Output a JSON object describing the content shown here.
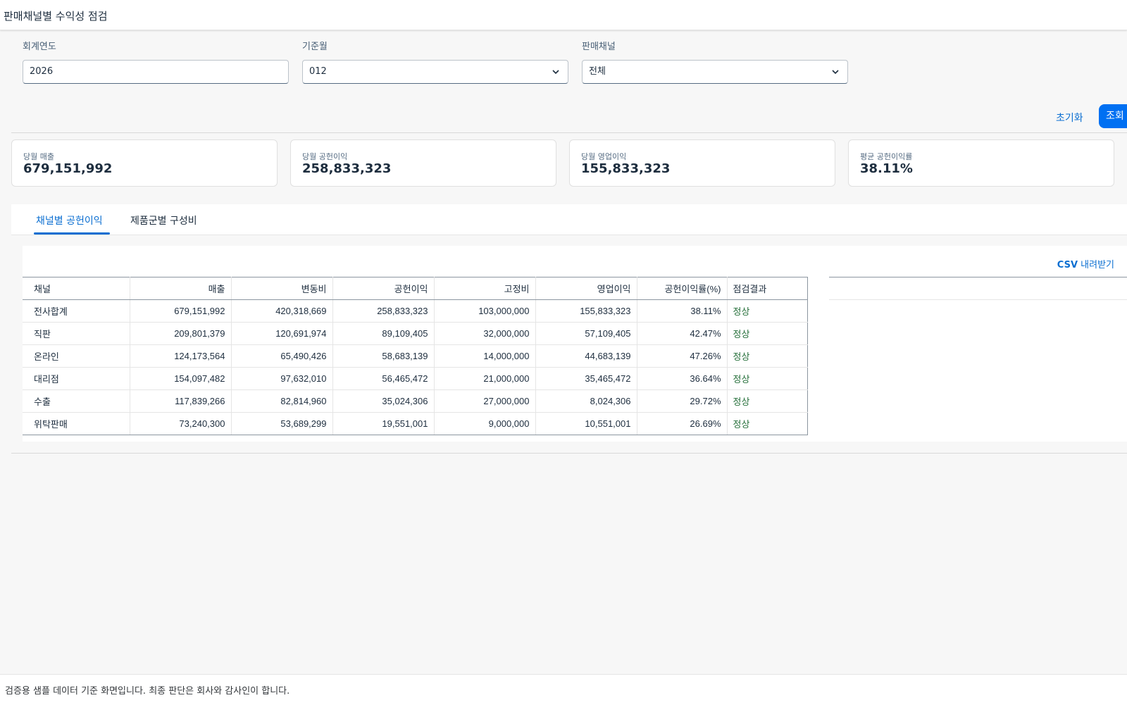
{
  "app": {
    "title": "판매채널별 수익성 점검"
  },
  "filters": {
    "year": {
      "label": "회계연도",
      "value": "2026"
    },
    "month": {
      "label": "기준월",
      "value": "012"
    },
    "channel": {
      "label": "판매채널",
      "value": "전체"
    }
  },
  "actions": {
    "reset": "초기화",
    "search": "조회"
  },
  "kpis": [
    {
      "label": "당월 매출",
      "value": "679,151,992"
    },
    {
      "label": "당월 공헌이익",
      "value": "258,833,323"
    },
    {
      "label": "당월 영업이익",
      "value": "155,833,323"
    },
    {
      "label": "평균 공헌이익률",
      "value": "38.11%"
    }
  ],
  "tabs": [
    {
      "label": "채널별 공헌이익",
      "active": true
    },
    {
      "label": "제품군별 구성비",
      "active": false
    }
  ],
  "table": {
    "csv": {
      "bold": "CSV",
      "rest": " 내려받기"
    },
    "headers": [
      "채널",
      "매출",
      "변동비",
      "공헌이익",
      "고정비",
      "영업이익",
      "공헌이익률(%)",
      "점검결과"
    ],
    "rows": [
      [
        "전사합계",
        "679,151,992",
        "420,318,669",
        "258,833,323",
        "103,000,000",
        "155,833,323",
        "38.11%",
        "정상"
      ],
      [
        "직판",
        "209,801,379",
        "120,691,974",
        "89,109,405",
        "32,000,000",
        "57,109,405",
        "42.47%",
        "정상"
      ],
      [
        "온라인",
        "124,173,564",
        "65,490,426",
        "58,683,139",
        "14,000,000",
        "44,683,139",
        "47.26%",
        "정상"
      ],
      [
        "대리점",
        "154,097,482",
        "97,632,010",
        "56,465,472",
        "21,000,000",
        "35,465,472",
        "36.64%",
        "정상"
      ],
      [
        "수출",
        "117,839,266",
        "82,814,960",
        "35,024,306",
        "27,000,000",
        "8,024,306",
        "29.72%",
        "정상"
      ],
      [
        "위탁판매",
        "73,240,300",
        "53,689,299",
        "19,551,001",
        "9,000,000",
        "10,551,001",
        "26.69%",
        "정상"
      ]
    ]
  },
  "footer": {
    "note": "검증용 샘플 데이터 기준 화면입니다. 최종 판단은 회사와 감사인이 합니다."
  },
  "colors": {
    "accent": "#0a6ed1",
    "primary_button": "#0070f2",
    "status_ok": "#256f3a"
  }
}
